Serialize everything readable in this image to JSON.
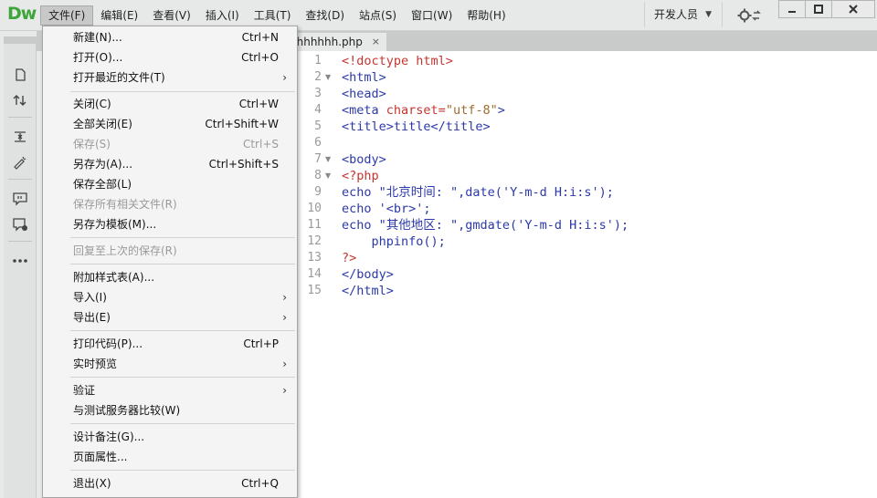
{
  "app": {
    "logo": "Dw"
  },
  "menubar": [
    {
      "label": "文件(F)"
    },
    {
      "label": "编辑(E)"
    },
    {
      "label": "查看(V)"
    },
    {
      "label": "插入(I)"
    },
    {
      "label": "工具(T)"
    },
    {
      "label": "查找(D)"
    },
    {
      "label": "站点(S)"
    },
    {
      "label": "窗口(W)"
    },
    {
      "label": "帮助(H)"
    }
  ],
  "workspace": {
    "label": "开发人员"
  },
  "document_tab": {
    "label": "hhhhhhh.php",
    "close_glyph": "×"
  },
  "file_menu": {
    "items": [
      {
        "label": "新建(N)...",
        "shortcut": "Ctrl+N"
      },
      {
        "label": "打开(O)...",
        "shortcut": "Ctrl+O"
      },
      {
        "label": "打开最近的文件(T)",
        "submenu": "›"
      },
      {
        "label": "关闭(C)",
        "shortcut": "Ctrl+W"
      },
      {
        "label": "全部关闭(E)",
        "shortcut": "Ctrl+Shift+W"
      },
      {
        "label": "保存(S)",
        "shortcut": "Ctrl+S",
        "disabled": true
      },
      {
        "label": "另存为(A)...",
        "shortcut": "Ctrl+Shift+S"
      },
      {
        "label": "保存全部(L)"
      },
      {
        "label": "保存所有相关文件(R)",
        "disabled": true
      },
      {
        "label": "另存为模板(M)..."
      },
      {
        "label": "回复至上次的保存(R)",
        "disabled": true
      },
      {
        "label": "附加样式表(A)..."
      },
      {
        "label": "导入(I)",
        "submenu": "›"
      },
      {
        "label": "导出(E)",
        "submenu": "›"
      },
      {
        "label": "打印代码(P)...",
        "shortcut": "Ctrl+P"
      },
      {
        "label": "实时预览",
        "submenu": "›"
      },
      {
        "label": "验证",
        "submenu": "›"
      },
      {
        "label": "与测试服务器比较(W)"
      },
      {
        "label": "设计备注(G)..."
      },
      {
        "label": "页面属性..."
      },
      {
        "label": "退出(X)",
        "shortcut": "Ctrl+Q"
      }
    ]
  },
  "code": {
    "line_numbers": [
      "1",
      "2",
      "3",
      "4",
      "5",
      "6",
      "7",
      "8",
      "9",
      "10",
      "11",
      "12",
      "13",
      "14",
      "15"
    ],
    "lines": [
      [
        "<!doctype html>"
      ],
      [
        "<html>"
      ],
      [
        "<head>"
      ],
      [
        "<meta ",
        "charset=",
        "\"utf-8\"",
        ">"
      ],
      [
        "<title>",
        "title",
        "</title>"
      ],
      [
        ""
      ],
      [
        "<body>"
      ],
      [
        "<?php"
      ],
      [
        "echo ",
        "\"北京时间: \"",
        ",date(",
        "'Y-m-d H:i:s'",
        ");"
      ],
      [
        "echo ",
        "'<br>'",
        ";"
      ],
      [
        "echo ",
        "\"其他地区: \"",
        ",gmdate(",
        "'Y-m-d H:i:s'",
        ");"
      ],
      [
        "    phpinfo();"
      ],
      [
        "?>"
      ],
      [
        "</body>"
      ],
      [
        "</html>"
      ]
    ]
  }
}
